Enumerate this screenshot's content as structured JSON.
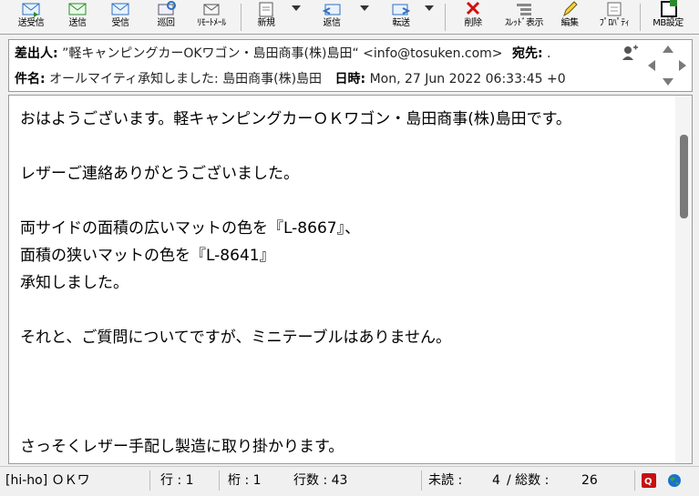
{
  "toolbar": {
    "buttons": [
      {
        "label": "送受信",
        "icon": "send-receive-icon"
      },
      {
        "label": "送信",
        "icon": "send-icon"
      },
      {
        "label": "受信",
        "icon": "receive-icon"
      },
      {
        "label": "巡回",
        "icon": "patrol-icon"
      },
      {
        "label": "ﾘﾓｰﾄﾒｰﾙ",
        "icon": "remote-mail-icon"
      },
      {
        "label": "新規",
        "icon": "new-mail-icon"
      },
      {
        "label": "返信",
        "icon": "reply-icon"
      },
      {
        "label": "転送",
        "icon": "forward-icon"
      },
      {
        "label": "削除",
        "icon": "delete-icon"
      },
      {
        "label": "ｽﾚｯﾄﾞ表示",
        "icon": "thread-view-icon"
      },
      {
        "label": "編集",
        "icon": "edit-icon"
      },
      {
        "label": "ﾌﾟﾛﾊﾟﾃｨ",
        "icon": "properties-icon"
      },
      {
        "label": "MB設定",
        "icon": "mailbox-settings-icon"
      }
    ]
  },
  "header": {
    "from_label": "差出人:",
    "from_value": "”軽キャンピングカーOKワゴン・島田商事(株)島田“ <info@tosuken.com>",
    "to_label": "宛先:",
    "to_value": ".",
    "subject_label": "件名:",
    "subject_value": "オールマイティ承知しました: 島田商事(株)島田",
    "date_label": "日時:",
    "date_value": "Mon, 27 Jun 2022 06:33:45 +0",
    "colors": {
      "accent": "#0078d7",
      "delete_red": "#d01010",
      "remote_green": "#2b8a2b"
    }
  },
  "body": {
    "text": "おはようございます。軽キャンピングカーＯＫワゴン・島田商事(株)島田です。\n\nレザーご連絡ありがとうございました。\n\n両サイドの面積の広いマットの色を『L-8667』、\n面積の狭いマットの色を『L-8641』\n承知しました。\n\nそれと、ご質問についてですが、ミニテーブルはありません。\n\n\n\nさっそくレザー手配し製造に取り掛かります。\nまた完成前にご連絡させて頂きます。"
  },
  "status": {
    "account": "[hi-ho] ＯＫワ",
    "row": "行 : 1",
    "col": "桁 : 1",
    "lines": "行数 : 43",
    "unread_label": "未読 :",
    "unread_value": "4",
    "total_label": "/ 総数 :",
    "total_value": "26"
  }
}
